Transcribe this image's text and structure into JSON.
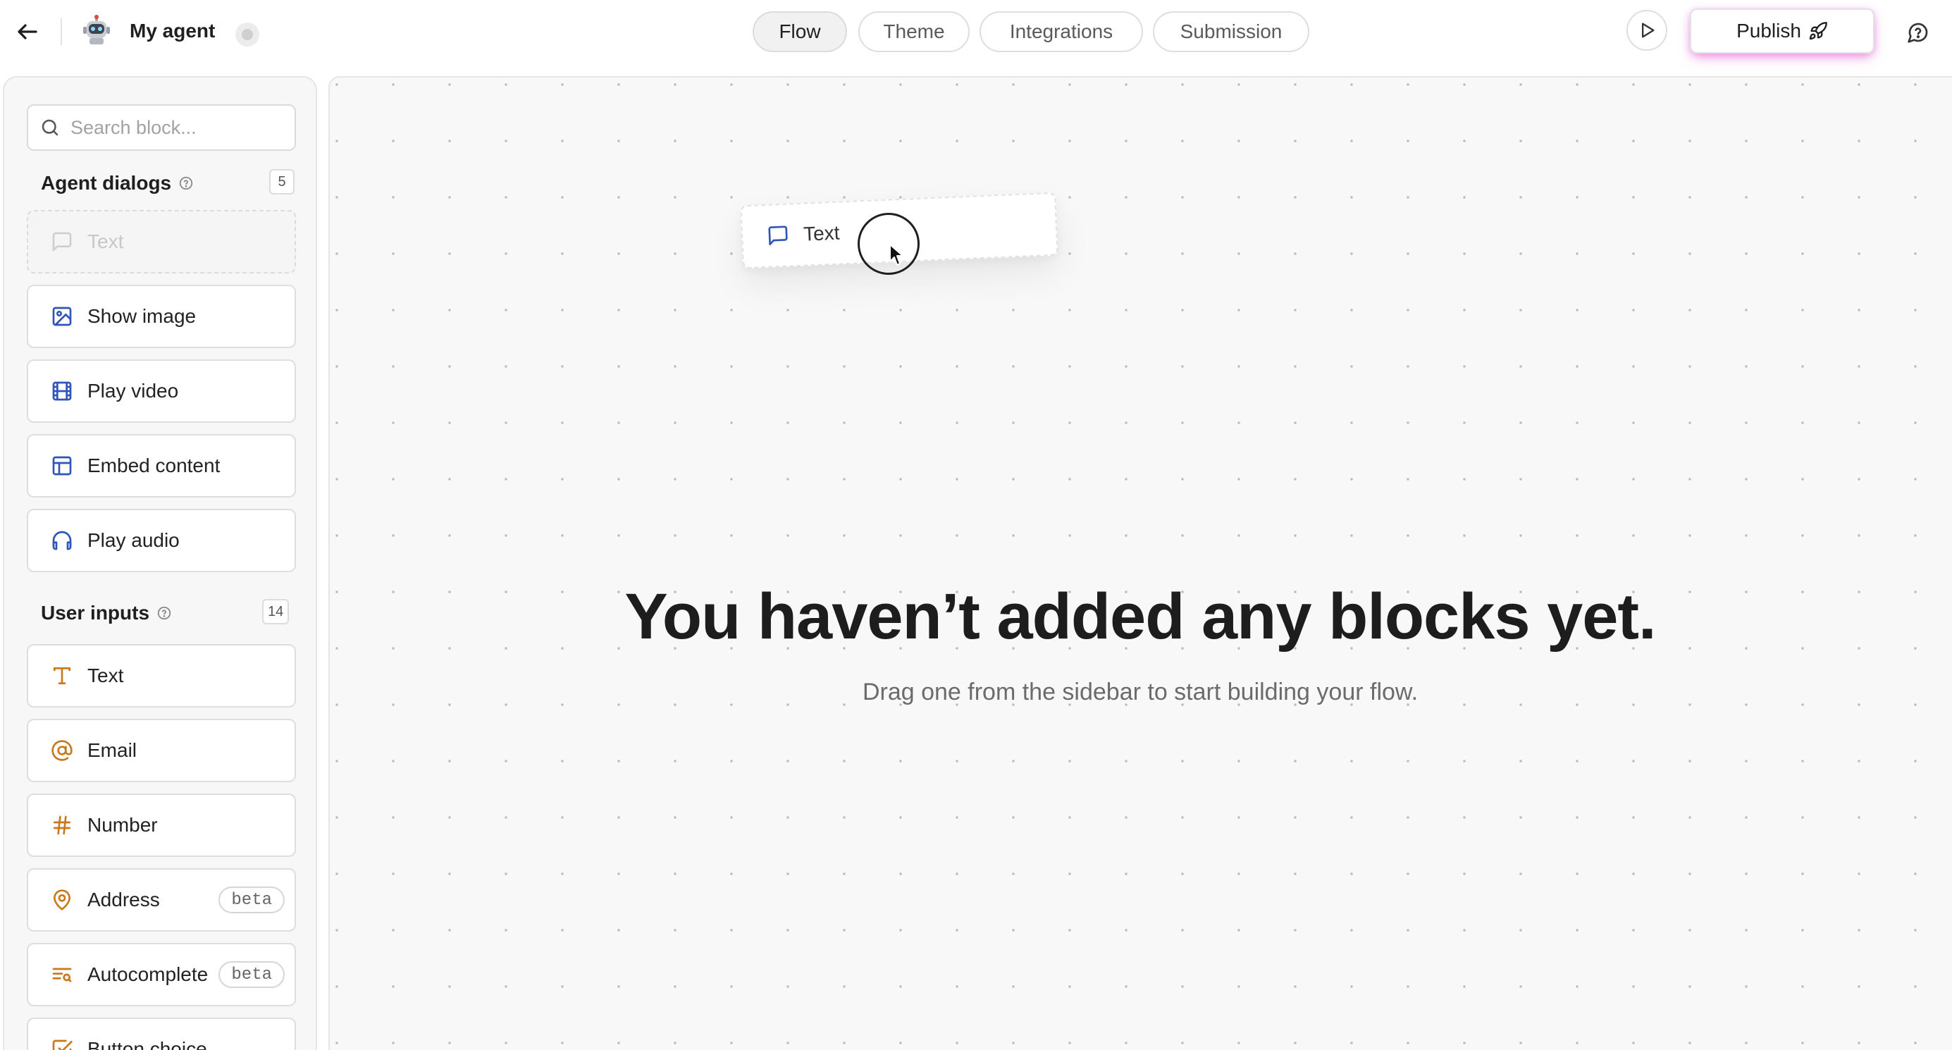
{
  "header": {
    "agent_name": "My agent",
    "tabs": [
      {
        "label": "Flow",
        "active": true
      },
      {
        "label": "Theme",
        "active": false
      },
      {
        "label": "Integrations",
        "active": false
      },
      {
        "label": "Submission",
        "active": false
      }
    ],
    "publish_label": "Publish",
    "publish_glow_color": "#e64bc8"
  },
  "sidebar": {
    "search_placeholder": "Search block...",
    "agent_dialogs": {
      "title": "Agent dialogs",
      "count": "5",
      "items": [
        {
          "label": "Text",
          "icon": "message-square-icon",
          "ghost": true
        },
        {
          "label": "Show image",
          "icon": "image-icon"
        },
        {
          "label": "Play video",
          "icon": "film-icon"
        },
        {
          "label": "Embed content",
          "icon": "layout-icon"
        },
        {
          "label": "Play audio",
          "icon": "headphones-icon"
        }
      ],
      "icon_color": "#2f55b8"
    },
    "user_inputs": {
      "title": "User inputs",
      "count": "14",
      "items": [
        {
          "label": "Text",
          "icon": "type-icon"
        },
        {
          "label": "Email",
          "icon": "at-sign-icon"
        },
        {
          "label": "Number",
          "icon": "hash-icon"
        },
        {
          "label": "Address",
          "icon": "map-pin-icon",
          "badge": "beta"
        },
        {
          "label": "Autocomplete",
          "icon": "list-search-icon",
          "badge": "beta"
        },
        {
          "label": "Button choice",
          "icon": "checkbox-icon"
        }
      ],
      "icon_color": "#c9781a"
    }
  },
  "canvas": {
    "dragging_block": {
      "label": "Text",
      "icon": "message-square-icon"
    },
    "empty_title": "You haven’t added any blocks yet.",
    "empty_subtitle": "Drag one from the sidebar to start building your flow."
  }
}
